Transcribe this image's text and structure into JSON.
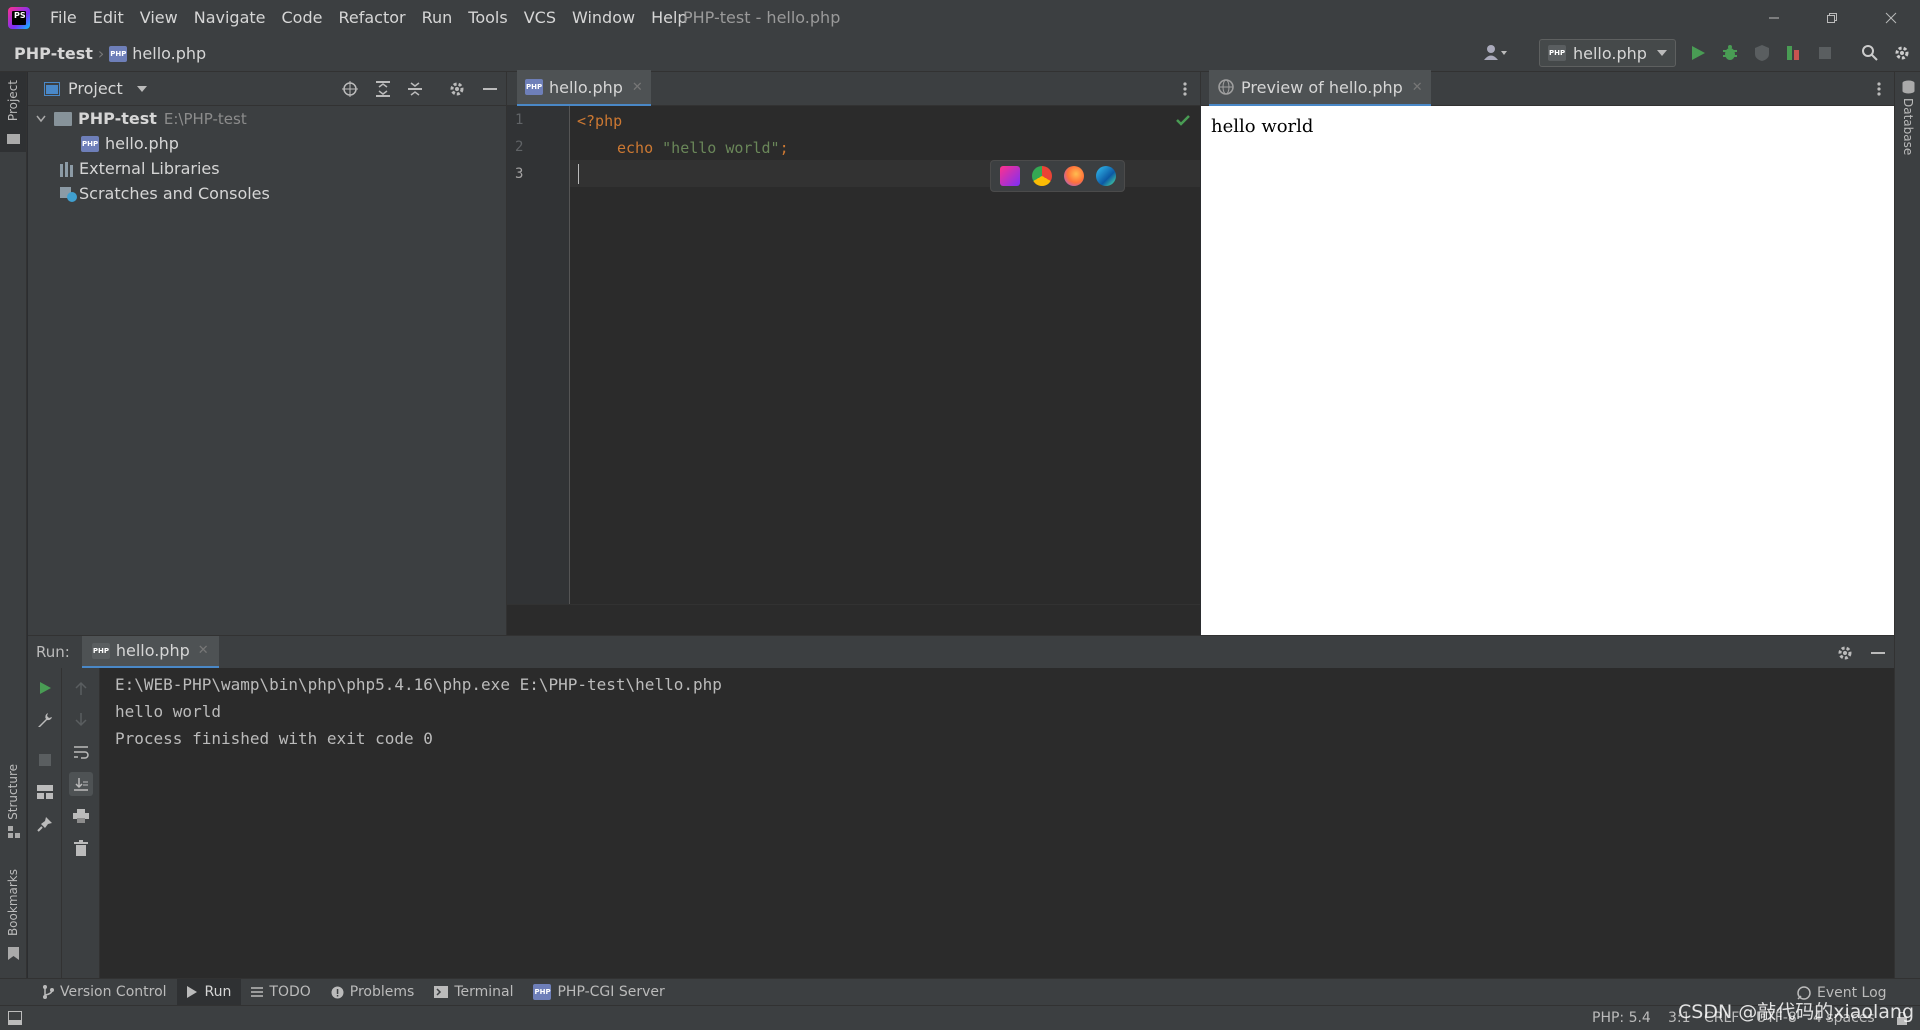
{
  "menu": [
    "File",
    "Edit",
    "View",
    "Navigate",
    "Code",
    "Refactor",
    "Run",
    "Tools",
    "VCS",
    "Window",
    "Help"
  ],
  "window_title": "PHP-test - hello.php",
  "breadcrumb": {
    "project": "PHP-test",
    "file": "hello.php"
  },
  "run_config": "hello.php",
  "left_stripe": {
    "project": "Project",
    "structure": "Structure",
    "bookmarks": "Bookmarks"
  },
  "right_stripe": {
    "database": "Database"
  },
  "project_panel": {
    "title": "Project",
    "tree": [
      {
        "label": "PHP-test",
        "path": "E:\\PHP-test"
      },
      {
        "label": "hello.php"
      },
      {
        "label": "External Libraries"
      },
      {
        "label": "Scratches and Consoles"
      }
    ]
  },
  "editor": {
    "tab": "hello.php",
    "line_numbers": [
      "1",
      "2",
      "3"
    ],
    "code": {
      "open_tag": "<?php",
      "echo_kw": "echo",
      "string": "\"hello world\"",
      "semicolon": ";"
    }
  },
  "preview": {
    "tab": "Preview of hello.php",
    "content": "hello world"
  },
  "run_panel": {
    "label": "Run:",
    "tab": "hello.php",
    "console": [
      "E:\\WEB-PHP\\wamp\\bin\\php\\php5.4.16\\php.exe E:\\PHP-test\\hello.php",
      "hello world",
      "Process finished with exit code 0"
    ]
  },
  "tool_tabs": [
    "Version Control",
    "Run",
    "TODO",
    "Problems",
    "Terminal",
    "PHP-CGI Server"
  ],
  "event_log": "Event Log",
  "status": {
    "php": "PHP: 5.4",
    "position": "3:1",
    "line_sep": "CRLF",
    "encoding": "UTF-8",
    "indent": "4 spaces"
  },
  "watermark": "CSDN @敲代码的xiaolang",
  "colors": {
    "accent": "#4a88c7",
    "run_green": "#499c54",
    "keyword": "#cc7832",
    "string": "#6a8759"
  }
}
